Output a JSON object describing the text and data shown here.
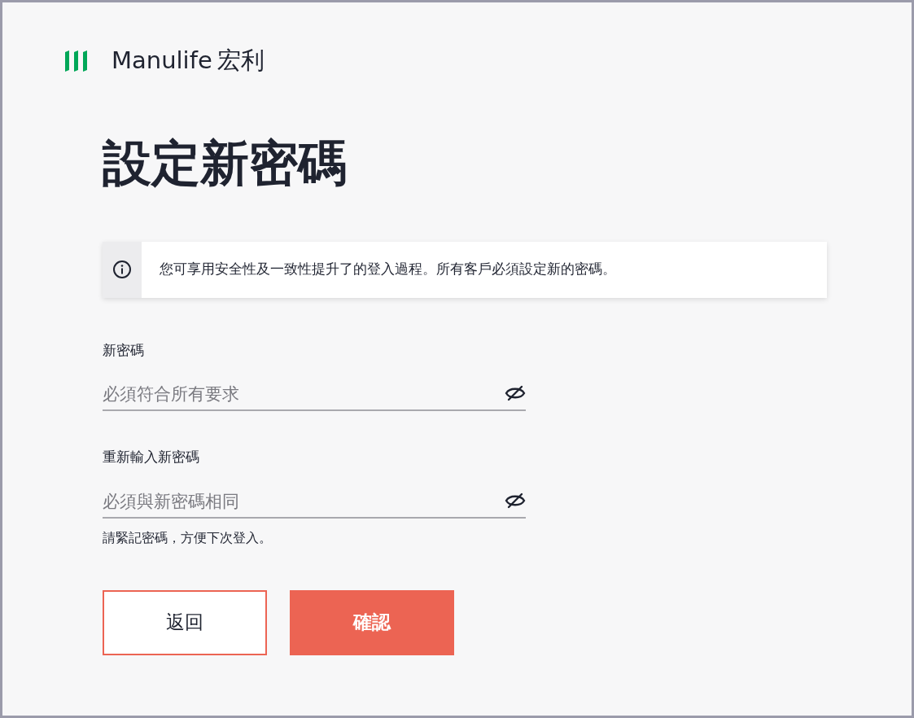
{
  "brand": {
    "name": "Manulife",
    "name_local": "宏利"
  },
  "title": "設定新密碼",
  "notice": "您可享用安全性及一致性提升了的登入過程。所有客戶必須設定新的密碼。",
  "fields": [
    {
      "label": "新密碼",
      "placeholder": "必須符合所有要求",
      "password_hidden": true
    },
    {
      "label": "重新輸入新密碼",
      "placeholder": "必須與新密碼相同",
      "password_hidden": true,
      "hint": "請緊記密碼，方便下次登入。"
    }
  ],
  "buttons": [
    {
      "label": "返回",
      "kind": "secondary"
    },
    {
      "label": "確認",
      "kind": "primary"
    }
  ]
}
